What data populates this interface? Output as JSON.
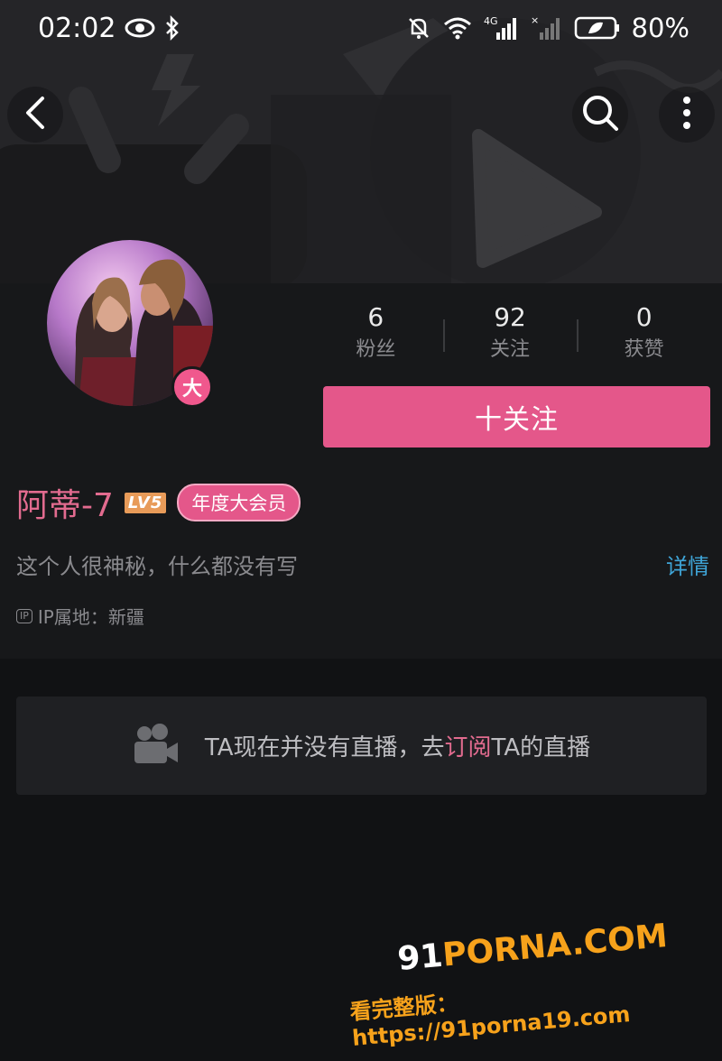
{
  "status_bar": {
    "time": "02:02",
    "battery": "80%",
    "network_label": "4G"
  },
  "nav": {
    "back_icon": "chevron-left-icon",
    "search_icon": "search-icon",
    "more_icon": "more-vertical-icon"
  },
  "profile": {
    "avatar_badge": "大",
    "name": "阿蒂-7",
    "level_badge": "LV5",
    "vip_badge": "年度大会员",
    "bio": "这个人很神秘，什么都没有写",
    "details_link": "详情",
    "ip_icon_text": "IP",
    "ip_location": "IP属地：新疆"
  },
  "stats": [
    {
      "value": "6",
      "label": "粉丝"
    },
    {
      "value": "92",
      "label": "关注"
    },
    {
      "value": "0",
      "label": "获赞"
    }
  ],
  "follow_button": "十关注",
  "live_card": {
    "text_before": "TA现在并没有直播，去",
    "link": "订阅",
    "text_after": "TA的直播"
  },
  "watermark": {
    "prefix": "91",
    "brand": "PORNA.COM",
    "line2": "看完整版：https://91porna19.com"
  },
  "colors": {
    "accent_pink": "#e4578a",
    "link_blue": "#3fa5d8",
    "level_orange": "#e89b59"
  }
}
